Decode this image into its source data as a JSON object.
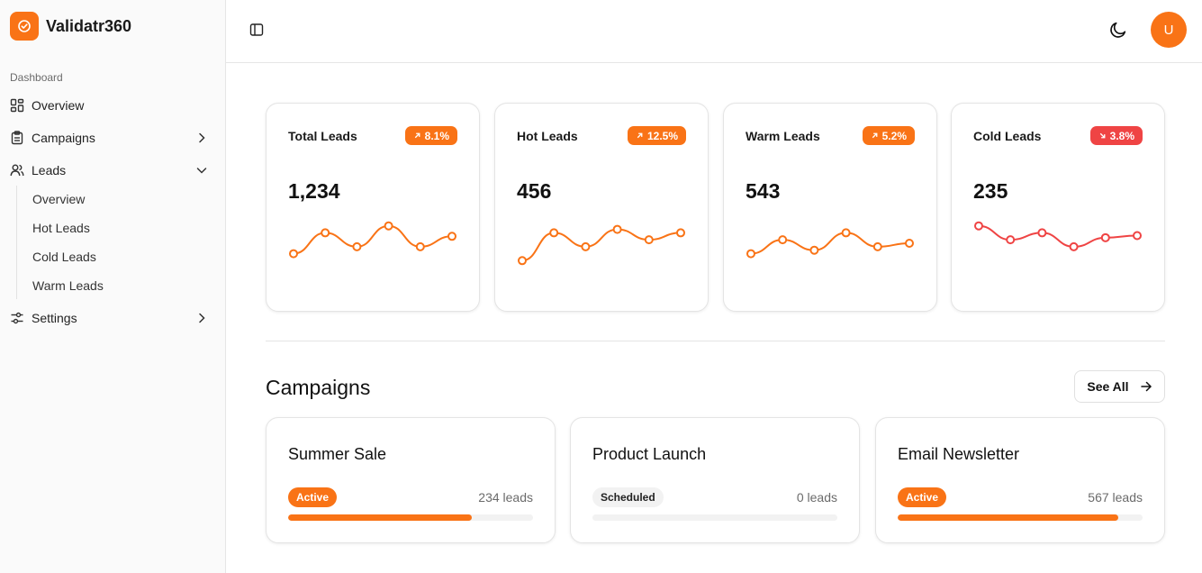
{
  "app": {
    "name": "Validatr360"
  },
  "colors": {
    "accent": "#f97316",
    "negative": "#ef4444"
  },
  "sidebar": {
    "section_label": "Dashboard",
    "items": [
      {
        "label": "Overview",
        "icon": "layout-grid-icon"
      },
      {
        "label": "Campaigns",
        "icon": "clipboard-icon"
      },
      {
        "label": "Leads",
        "icon": "users-icon"
      },
      {
        "label": "Settings",
        "icon": "sliders-icon"
      }
    ],
    "lead_subitems": [
      "Overview",
      "Hot Leads",
      "Cold Leads",
      "Warm Leads"
    ]
  },
  "header": {
    "avatar_initial": "U"
  },
  "stats": [
    {
      "title": "Total Leads",
      "value": "1,234",
      "change": "8.1%",
      "trend": "up",
      "color": "#f97316",
      "spark": [
        4,
        7,
        5,
        8,
        5,
        6.5
      ]
    },
    {
      "title": "Hot Leads",
      "value": "456",
      "change": "12.5%",
      "trend": "up",
      "color": "#f97316",
      "spark": [
        3,
        7,
        5,
        7.5,
        6,
        7
      ]
    },
    {
      "title": "Warm Leads",
      "value": "543",
      "change": "5.2%",
      "trend": "up",
      "color": "#f97316",
      "spark": [
        4,
        6,
        4.5,
        7,
        5,
        5.5
      ]
    },
    {
      "title": "Cold Leads",
      "value": "235",
      "change": "3.8%",
      "trend": "down",
      "color": "#ef4444",
      "spark": [
        8,
        6,
        7,
        5,
        6.3,
        6.6
      ]
    }
  ],
  "campaigns": {
    "title": "Campaigns",
    "see_all": "See All",
    "items": [
      {
        "name": "Summer Sale",
        "status": "Active",
        "status_type": "active",
        "leads": "234 leads",
        "progress": 0.75
      },
      {
        "name": "Product Launch",
        "status": "Scheduled",
        "status_type": "scheduled",
        "leads": "0 leads",
        "progress": 0
      },
      {
        "name": "Email Newsletter",
        "status": "Active",
        "status_type": "active",
        "leads": "567 leads",
        "progress": 0.9
      }
    ]
  }
}
